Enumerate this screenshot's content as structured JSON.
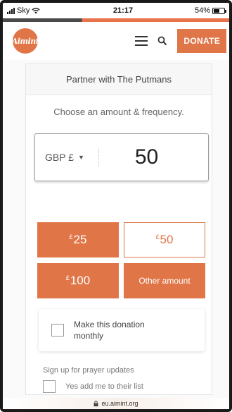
{
  "status_bar": {
    "carrier": "Sky",
    "time": "21:17",
    "battery_percent": "54%",
    "battery_level": 0.54,
    "icons": [
      "signal-icon",
      "wifi-icon",
      "battery-icon"
    ]
  },
  "header": {
    "logo_text": "Aimint",
    "donate_label": "DONATE",
    "icons": [
      "menu-icon",
      "search-icon"
    ],
    "accent_color": "#e07648"
  },
  "card": {
    "title": "Partner with The Putmans",
    "instruction": "Choose an amount & frequency.",
    "currency": "GBP £",
    "amount": "50",
    "presets": [
      {
        "symbol": "£",
        "value": "25",
        "style": "filled"
      },
      {
        "symbol": "£",
        "value": "50",
        "style": "outline"
      },
      {
        "symbol": "£",
        "value": "100",
        "style": "filled"
      },
      {
        "symbol": "",
        "value": "Other amount",
        "style": "filled"
      }
    ],
    "monthly_label": "Make this donation monthly",
    "prayer_title": "Sign up for prayer updates",
    "prayer_label": "Yes add me to their list"
  },
  "url_bar": {
    "url": "eu.aimint.org"
  }
}
